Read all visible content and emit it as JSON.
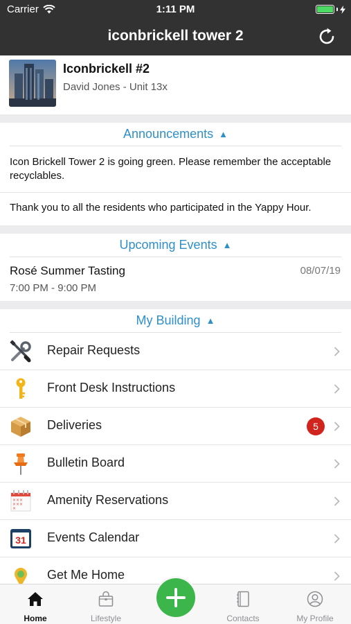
{
  "status_bar": {
    "carrier": "Carrier",
    "time": "1:11 PM"
  },
  "nav": {
    "title": "iconbrickell tower 2",
    "refresh_icon": "refresh-icon"
  },
  "profile": {
    "name": "Iconbrickell #2",
    "subtitle": "David Jones - Unit 13x"
  },
  "announcements": {
    "header": "Announcements",
    "items": [
      "Icon Brickell Tower 2 is going green. Please remember the acceptable recyclables.",
      "Thank you to all the residents who participated in the Yappy Hour."
    ]
  },
  "events": {
    "header": "Upcoming Events",
    "items": [
      {
        "name": "Rosé Summer Tasting",
        "time": "7:00 PM - 9:00 PM",
        "date": "08/07/19"
      }
    ]
  },
  "building": {
    "header": "My Building",
    "items": [
      {
        "label": "Repair Requests",
        "icon": "tools-icon"
      },
      {
        "label": "Front Desk Instructions",
        "icon": "key-icon"
      },
      {
        "label": "Deliveries",
        "icon": "package-icon",
        "badge": "5"
      },
      {
        "label": "Bulletin Board",
        "icon": "pushpin-icon"
      },
      {
        "label": "Amenity Reservations",
        "icon": "calendar-grid-icon"
      },
      {
        "label": "Events Calendar",
        "icon": "calendar-icon",
        "icon_text": "31"
      },
      {
        "label": "Get Me Home",
        "icon": "map-pin-icon"
      }
    ]
  },
  "tabs": [
    {
      "label": "Home",
      "icon": "home-icon",
      "active": true
    },
    {
      "label": "Lifestyle",
      "icon": "bag-icon"
    },
    {
      "label": "",
      "icon": "plus-icon"
    },
    {
      "label": "Contacts",
      "icon": "contacts-book-icon"
    },
    {
      "label": "My Profile",
      "icon": "user-circle-icon"
    }
  ],
  "colors": {
    "header_bg": "#323232",
    "accent": "#2f8fc9",
    "fab": "#3cb54a",
    "badge": "#d0241d"
  }
}
